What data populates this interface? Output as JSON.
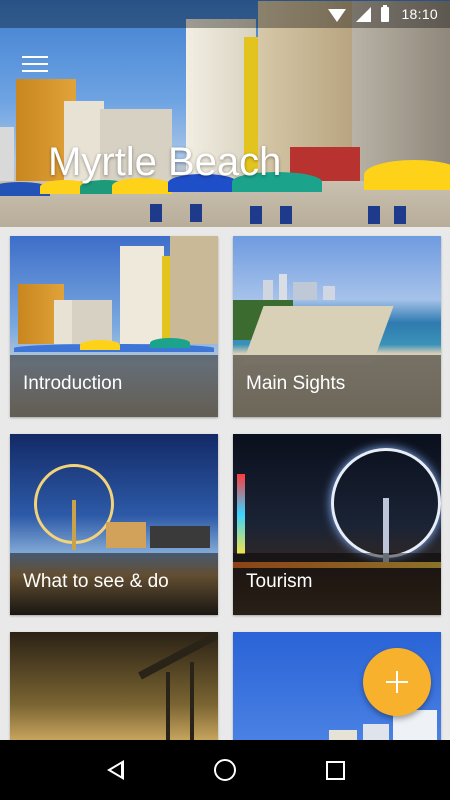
{
  "status_bar": {
    "time": "18:10"
  },
  "header": {
    "title": "Myrtle Beach"
  },
  "cards": [
    {
      "label": "Introduction"
    },
    {
      "label": "Main Sights"
    },
    {
      "label": "What to see & do"
    },
    {
      "label": "Tourism"
    },
    {
      "label": ""
    },
    {
      "label": ""
    }
  ],
  "icons": {
    "menu": "menu-icon",
    "fab": "plus-icon",
    "nav": [
      "back-icon",
      "home-icon",
      "recents-icon"
    ]
  },
  "colors": {
    "accent": "#f7b12c",
    "caption_bg": "rgba(0,0,0,0.45)",
    "nav_bg": "#000000"
  }
}
